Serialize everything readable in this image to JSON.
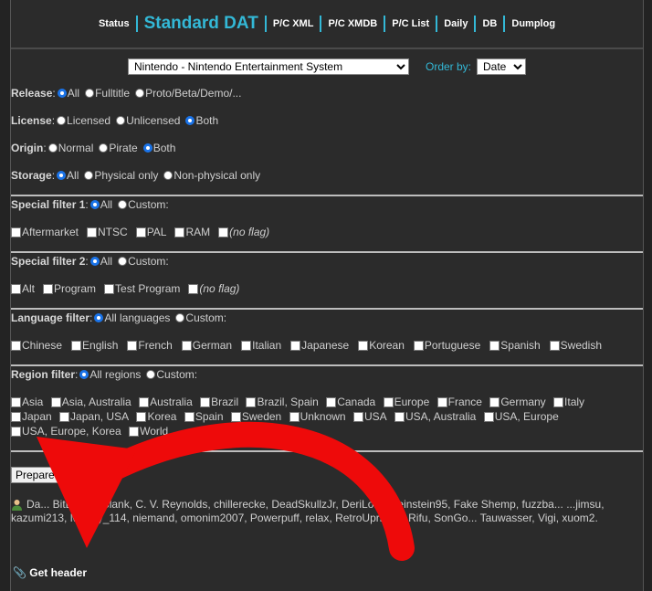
{
  "nav": {
    "status": "Status",
    "standard_dat": "Standard DAT",
    "pc_xml": "P/C XML",
    "pc_xmdb": "P/C XMDB",
    "pc_list": "P/C List",
    "daily": "Daily",
    "db": "DB",
    "dumplog": "Dumplog"
  },
  "system_select": {
    "value": "Nintendo - Nintendo Entertainment System"
  },
  "order": {
    "label": "Order by:",
    "value": "Date"
  },
  "release": {
    "label": "Release",
    "options": [
      "All",
      "Fulltitle",
      "Proto/Beta/Demo/..."
    ],
    "selected": 0
  },
  "license": {
    "label": "License",
    "options": [
      "Licensed",
      "Unlicensed",
      "Both"
    ],
    "selected": 2
  },
  "origin": {
    "label": "Origin",
    "options": [
      "Normal",
      "Pirate",
      "Both"
    ],
    "selected": 2
  },
  "storage": {
    "label": "Storage",
    "options": [
      "All",
      "Physical only",
      "Non-physical only"
    ],
    "selected": 0
  },
  "special1": {
    "label": "Special filter 1",
    "options": [
      "All",
      "Custom:"
    ],
    "selected": 0,
    "flags": [
      "Aftermarket",
      "NTSC",
      "PAL",
      "RAM",
      "(no flag)"
    ]
  },
  "special2": {
    "label": "Special filter 2",
    "options": [
      "All",
      "Custom:"
    ],
    "selected": 0,
    "flags": [
      "Alt",
      "Program",
      "Test Program",
      "(no flag)"
    ]
  },
  "language": {
    "label": "Language filter",
    "options": [
      "All languages",
      "Custom:"
    ],
    "selected": 0,
    "items": [
      "Chinese",
      "English",
      "French",
      "German",
      "Italian",
      "Japanese",
      "Korean",
      "Portuguese",
      "Spanish",
      "Swedish"
    ]
  },
  "region": {
    "label": "Region filter",
    "options": [
      "All regions",
      "Custom:"
    ],
    "selected": 0,
    "items": [
      "Asia",
      "Asia, Australia",
      "Australia",
      "Brazil",
      "Brazil, Spain",
      "Canada",
      "Europe",
      "France",
      "Germany",
      "Italy",
      "Japan",
      "Japan, USA",
      "Korea",
      "Spain",
      "Sweden",
      "Unknown",
      "USA",
      "USA, Australia",
      "USA, Europe",
      "USA, Europe, Korea",
      "World"
    ]
  },
  "prepare_button": "Prepare",
  "credits": "Da... BitLooter, Blank, C. V. Reynolds, chillerecke, DeadSkullzJr, DeriLoko3, einstein95, Fake Shemp, fuzzba... ...jimsu, kazumi213, Money_114, niemand, omonim2007, Powerpuff, relax, RetroUprising, Rifu, SonGo... Tauwasser, Vigi, xuom2.",
  "get_header": "Get header",
  "colors": {
    "accent": "#33b8d6",
    "arrow": "#ee0a0a",
    "background": "#2b2b2b"
  }
}
